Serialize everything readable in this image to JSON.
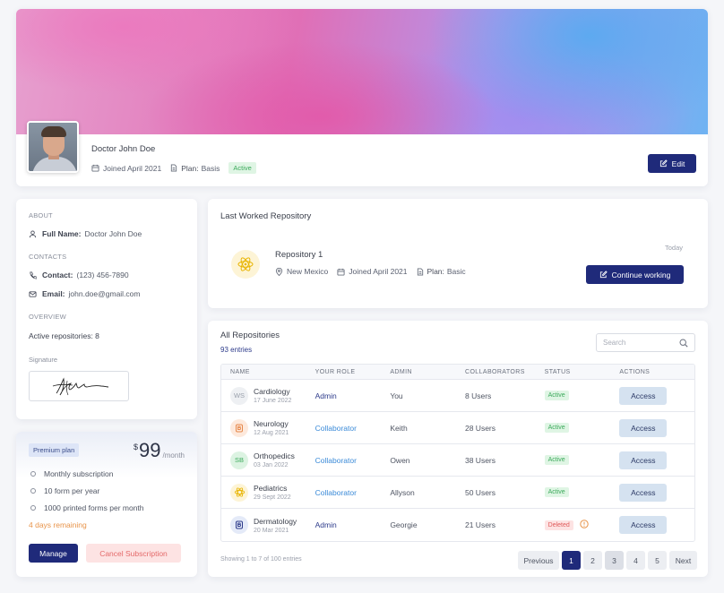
{
  "profile": {
    "name": "Doctor John Doe",
    "joined": "Joined April 2021",
    "plan_label": "Plan:",
    "plan_value": "Basis",
    "status": "Active",
    "edit_label": "Edit"
  },
  "about": {
    "about_header": "ABOUT",
    "full_name_label": "Full Name:",
    "full_name_value": "Doctor John Doe",
    "contacts_header": "CONTACTS",
    "contact_label": "Contact:",
    "contact_value": "(123) 456-7890",
    "email_label": "Email:",
    "email_value": "john.doe@gmail.com",
    "overview_header": "OVERVIEW",
    "active_repos": "Active repositories: 8",
    "signature_label": "Signature"
  },
  "plan": {
    "badge": "Premium plan",
    "currency": "$",
    "amount": "99",
    "period": "/month",
    "features": [
      "Monthly subscription",
      "10 form per year",
      "1000 printed forms per month"
    ],
    "days_remaining": "4 days remaining",
    "manage_label": "Manage",
    "cancel_label": "Cancel Subscription"
  },
  "last_worked": {
    "title": "Last Worked Repository",
    "when": "Today",
    "repo_name": "Repository 1",
    "location": "New Mexico",
    "joined": "Joined April 2021",
    "plan_label": "Plan:",
    "plan_value": "Basic",
    "continue_label": "Continue working"
  },
  "repositories": {
    "title": "All Repositories",
    "count": "93 entries",
    "search_placeholder": "Search",
    "columns": [
      "NAME",
      "YOUR ROLE",
      "ADMIN",
      "COLLABORATORS",
      "STATUS",
      "ACTIONS"
    ],
    "rows": [
      {
        "icon": "WS",
        "icon_bg": "#eef0f3",
        "icon_color": "#9aa0ab",
        "name": "Cardiology",
        "date": "17 June 2022",
        "role": "Admin",
        "admin": "You",
        "collaborators": "8 Users",
        "status": "Active",
        "action": "Access"
      },
      {
        "icon": "B",
        "icon_bg": "#fde9dc",
        "icon_color": "#e6884a",
        "name": "Neurology",
        "date": "12 Aug 2021",
        "role": "Collaborator",
        "admin": "Keith",
        "collaborators": "28 Users",
        "status": "Active",
        "action": "Access"
      },
      {
        "icon": "SB",
        "icon_bg": "#dcf3e2",
        "icon_color": "#3daa5c",
        "name": "Orthopedics",
        "date": "03 Jan 2022",
        "role": "Collaborator",
        "admin": "Owen",
        "collaborators": "38 Users",
        "status": "Active",
        "action": "Access"
      },
      {
        "icon": "*",
        "icon_bg": "#fdf4d6",
        "icon_color": "#e8b400",
        "name": "Pediatrics",
        "date": "29 Sept 2022",
        "role": "Collaborator",
        "admin": "Allyson",
        "collaborators": "50 Users",
        "status": "Active",
        "action": "Access"
      },
      {
        "icon": "B",
        "icon_bg": "#e4eaf8",
        "icon_color": "#2c3a8a",
        "name": "Dermatology",
        "date": "20 Mar 2021",
        "role": "Admin",
        "admin": "Georgie",
        "collaborators": "21 Users",
        "status": "Deleted",
        "action": "Access"
      }
    ],
    "showing": "Showing 1 to 7 of 100 entries",
    "pagination": {
      "previous": "Previous",
      "pages": [
        "1",
        "2",
        "3",
        "4",
        "5"
      ],
      "next": "Next",
      "current": "1"
    }
  },
  "colors": {
    "primary": "#1f2a7a",
    "active_green": "#3daa5c",
    "deleted_red": "#e05a5a",
    "warning_orange": "#e8944a"
  }
}
